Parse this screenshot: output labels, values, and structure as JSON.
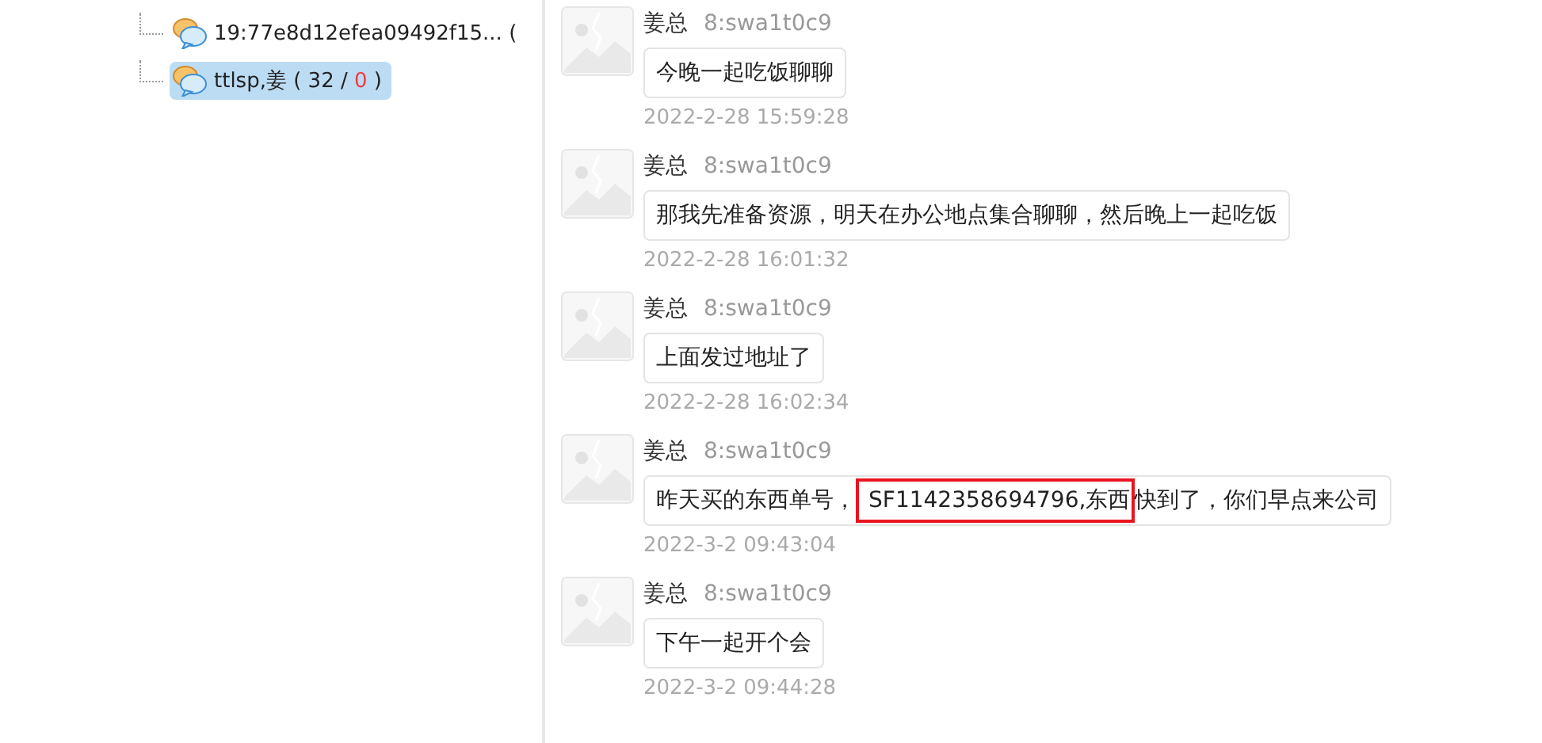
{
  "tree": {
    "items": [
      {
        "label": "19:77e8d12efea09492f15... (",
        "selected": false
      },
      {
        "label": "ttlsp,姜 ( 32 / ",
        "unread": "0",
        "suffix": " )",
        "selected": true
      }
    ]
  },
  "messages": [
    {
      "sender": "姜总",
      "account": "8:swa1t0c9",
      "segments": [
        {
          "text": "今晚一起吃饭聊聊",
          "highlighted": false
        }
      ],
      "time": "2022-2-28 15:59:28"
    },
    {
      "sender": "姜总",
      "account": "8:swa1t0c9",
      "segments": [
        {
          "text": "那我先准备资源，明天在办公地点集合聊聊，然后晚上一起吃饭",
          "highlighted": false
        }
      ],
      "time": "2022-2-28 16:01:32"
    },
    {
      "sender": "姜总",
      "account": "8:swa1t0c9",
      "segments": [
        {
          "text": "上面发过地址了",
          "highlighted": false
        }
      ],
      "time": "2022-2-28 16:02:34"
    },
    {
      "sender": "姜总",
      "account": "8:swa1t0c9",
      "segments": [
        {
          "text": "昨天买的东西单号，",
          "highlighted": false
        },
        {
          "text": "SF1142358694796,东西",
          "highlighted": true
        },
        {
          "text": "快到了，你们早点来公司",
          "highlighted": false
        }
      ],
      "time": "2022-3-2 09:43:04"
    },
    {
      "sender": "姜总",
      "account": "8:swa1t0c9",
      "segments": [
        {
          "text": "下午一起开个会",
          "highlighted": false
        }
      ],
      "time": "2022-3-2 09:44:28"
    }
  ]
}
